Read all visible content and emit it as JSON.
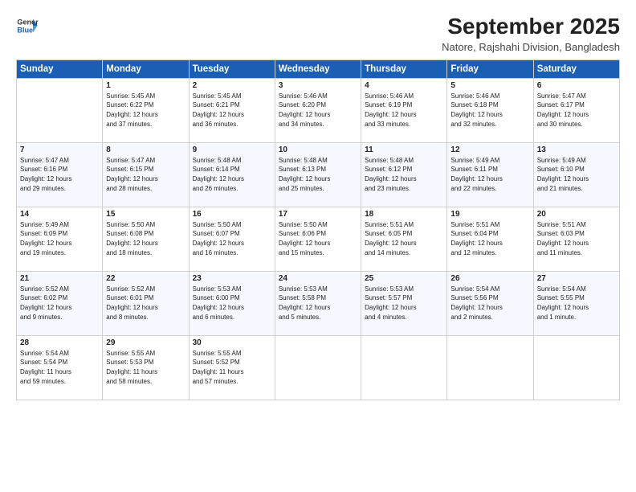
{
  "header": {
    "logo_line1": "General",
    "logo_line2": "Blue",
    "month_title": "September 2025",
    "subtitle": "Natore, Rajshahi Division, Bangladesh"
  },
  "days_of_week": [
    "Sunday",
    "Monday",
    "Tuesday",
    "Wednesday",
    "Thursday",
    "Friday",
    "Saturday"
  ],
  "weeks": [
    [
      {
        "day": "",
        "info": ""
      },
      {
        "day": "1",
        "info": "Sunrise: 5:45 AM\nSunset: 6:22 PM\nDaylight: 12 hours\nand 37 minutes."
      },
      {
        "day": "2",
        "info": "Sunrise: 5:45 AM\nSunset: 6:21 PM\nDaylight: 12 hours\nand 36 minutes."
      },
      {
        "day": "3",
        "info": "Sunrise: 5:46 AM\nSunset: 6:20 PM\nDaylight: 12 hours\nand 34 minutes."
      },
      {
        "day": "4",
        "info": "Sunrise: 5:46 AM\nSunset: 6:19 PM\nDaylight: 12 hours\nand 33 minutes."
      },
      {
        "day": "5",
        "info": "Sunrise: 5:46 AM\nSunset: 6:18 PM\nDaylight: 12 hours\nand 32 minutes."
      },
      {
        "day": "6",
        "info": "Sunrise: 5:47 AM\nSunset: 6:17 PM\nDaylight: 12 hours\nand 30 minutes."
      }
    ],
    [
      {
        "day": "7",
        "info": "Sunrise: 5:47 AM\nSunset: 6:16 PM\nDaylight: 12 hours\nand 29 minutes."
      },
      {
        "day": "8",
        "info": "Sunrise: 5:47 AM\nSunset: 6:15 PM\nDaylight: 12 hours\nand 28 minutes."
      },
      {
        "day": "9",
        "info": "Sunrise: 5:48 AM\nSunset: 6:14 PM\nDaylight: 12 hours\nand 26 minutes."
      },
      {
        "day": "10",
        "info": "Sunrise: 5:48 AM\nSunset: 6:13 PM\nDaylight: 12 hours\nand 25 minutes."
      },
      {
        "day": "11",
        "info": "Sunrise: 5:48 AM\nSunset: 6:12 PM\nDaylight: 12 hours\nand 23 minutes."
      },
      {
        "day": "12",
        "info": "Sunrise: 5:49 AM\nSunset: 6:11 PM\nDaylight: 12 hours\nand 22 minutes."
      },
      {
        "day": "13",
        "info": "Sunrise: 5:49 AM\nSunset: 6:10 PM\nDaylight: 12 hours\nand 21 minutes."
      }
    ],
    [
      {
        "day": "14",
        "info": "Sunrise: 5:49 AM\nSunset: 6:09 PM\nDaylight: 12 hours\nand 19 minutes."
      },
      {
        "day": "15",
        "info": "Sunrise: 5:50 AM\nSunset: 6:08 PM\nDaylight: 12 hours\nand 18 minutes."
      },
      {
        "day": "16",
        "info": "Sunrise: 5:50 AM\nSunset: 6:07 PM\nDaylight: 12 hours\nand 16 minutes."
      },
      {
        "day": "17",
        "info": "Sunrise: 5:50 AM\nSunset: 6:06 PM\nDaylight: 12 hours\nand 15 minutes."
      },
      {
        "day": "18",
        "info": "Sunrise: 5:51 AM\nSunset: 6:05 PM\nDaylight: 12 hours\nand 14 minutes."
      },
      {
        "day": "19",
        "info": "Sunrise: 5:51 AM\nSunset: 6:04 PM\nDaylight: 12 hours\nand 12 minutes."
      },
      {
        "day": "20",
        "info": "Sunrise: 5:51 AM\nSunset: 6:03 PM\nDaylight: 12 hours\nand 11 minutes."
      }
    ],
    [
      {
        "day": "21",
        "info": "Sunrise: 5:52 AM\nSunset: 6:02 PM\nDaylight: 12 hours\nand 9 minutes."
      },
      {
        "day": "22",
        "info": "Sunrise: 5:52 AM\nSunset: 6:01 PM\nDaylight: 12 hours\nand 8 minutes."
      },
      {
        "day": "23",
        "info": "Sunrise: 5:53 AM\nSunset: 6:00 PM\nDaylight: 12 hours\nand 6 minutes."
      },
      {
        "day": "24",
        "info": "Sunrise: 5:53 AM\nSunset: 5:58 PM\nDaylight: 12 hours\nand 5 minutes."
      },
      {
        "day": "25",
        "info": "Sunrise: 5:53 AM\nSunset: 5:57 PM\nDaylight: 12 hours\nand 4 minutes."
      },
      {
        "day": "26",
        "info": "Sunrise: 5:54 AM\nSunset: 5:56 PM\nDaylight: 12 hours\nand 2 minutes."
      },
      {
        "day": "27",
        "info": "Sunrise: 5:54 AM\nSunset: 5:55 PM\nDaylight: 12 hours\nand 1 minute."
      }
    ],
    [
      {
        "day": "28",
        "info": "Sunrise: 5:54 AM\nSunset: 5:54 PM\nDaylight: 11 hours\nand 59 minutes."
      },
      {
        "day": "29",
        "info": "Sunrise: 5:55 AM\nSunset: 5:53 PM\nDaylight: 11 hours\nand 58 minutes."
      },
      {
        "day": "30",
        "info": "Sunrise: 5:55 AM\nSunset: 5:52 PM\nDaylight: 11 hours\nand 57 minutes."
      },
      {
        "day": "",
        "info": ""
      },
      {
        "day": "",
        "info": ""
      },
      {
        "day": "",
        "info": ""
      },
      {
        "day": "",
        "info": ""
      }
    ]
  ]
}
